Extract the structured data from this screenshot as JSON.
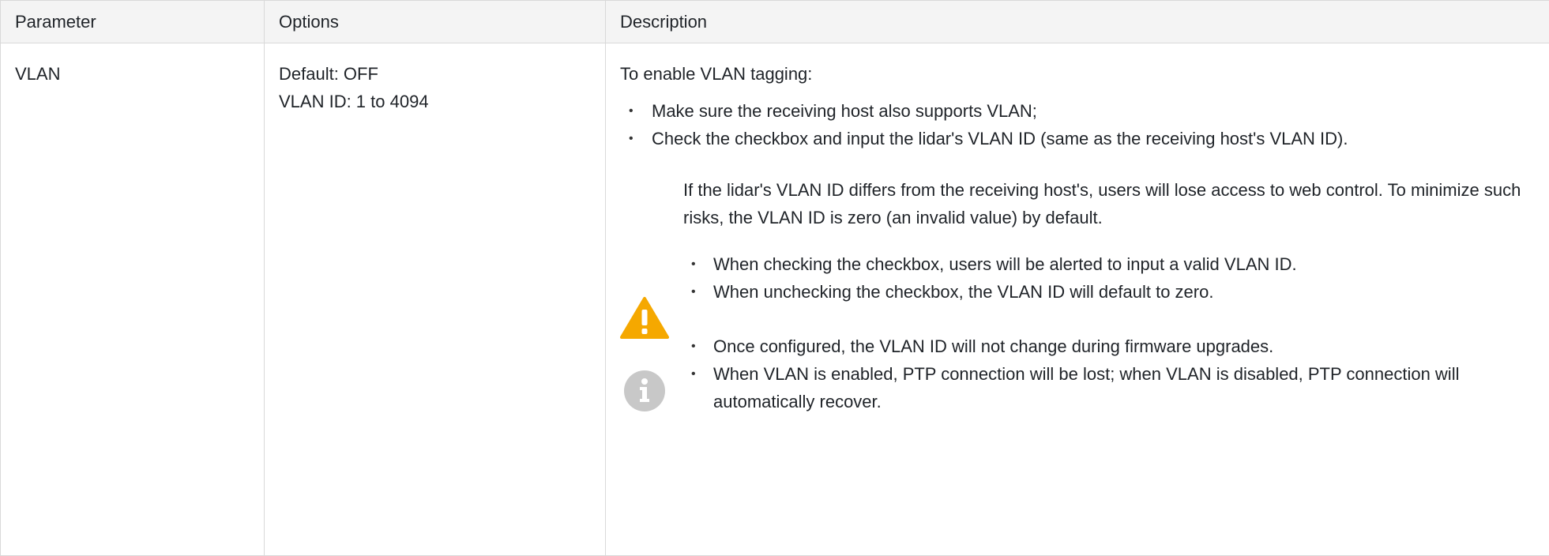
{
  "table": {
    "headers": [
      "Parameter",
      "Options",
      "Description"
    ],
    "rows": [
      {
        "parameter": "VLAN",
        "options": [
          "Default: OFF",
          "VLAN ID: 1 to 4094"
        ],
        "description": {
          "intro": "To enable VLAN tagging:",
          "steps": [
            "Make sure the receiving host also supports VLAN;",
            "Check the checkbox and input the lidar's VLAN ID (same as the receiving host's VLAN ID)."
          ],
          "warning": {
            "icon": "warning-icon",
            "text": "If the lidar's VLAN ID differs from the receiving host's, users will lose access to web control. To minimize such risks, the VLAN ID is zero (an invalid value) by default.",
            "items": [
              "When checking the checkbox, users will be alerted to input a valid VLAN ID.",
              "When unchecking the checkbox, the VLAN ID will default to zero."
            ]
          },
          "note": {
            "icon": "info-icon",
            "items": [
              "Once configured, the VLAN ID will not change during firmware upgrades.",
              "When VLAN is enabled, PTP connection will be lost; when VLAN is disabled, PTP connection will automatically recover."
            ]
          }
        }
      }
    ]
  },
  "colors": {
    "warning": "#f5a800",
    "info": "#c8c8c8",
    "header_bg": "#f4f4f4",
    "border": "#d9d9d9"
  }
}
